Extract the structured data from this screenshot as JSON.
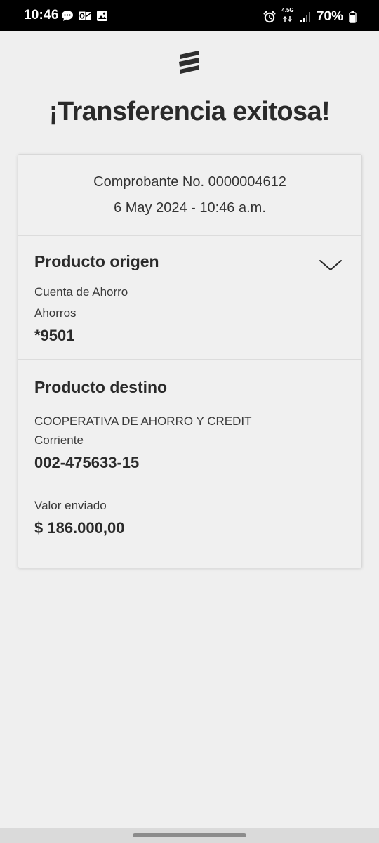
{
  "status_bar": {
    "time": "10:46",
    "network": "4.5G",
    "battery": "70%"
  },
  "page": {
    "title": "¡Transferencia exitosa!"
  },
  "receipt": {
    "number_line": "Comprobante No. 0000004612",
    "datetime": "6 May 2024 - 10:46 a.m."
  },
  "origin": {
    "title": "Producto origen",
    "account_type": "Cuenta de Ahorro",
    "sub_type": "Ahorros",
    "account_number": "*9501"
  },
  "destination": {
    "title": "Producto destino",
    "entity": "COOPERATIVA DE AHORRO Y CREDIT",
    "account_type": "Corriente",
    "account_number": "002-475633-15",
    "amount_label": "Valor enviado",
    "amount": "$ 186.000,00"
  },
  "icons": {
    "chat": "message-bubble-icon",
    "outlook": "mail-app-icon",
    "gallery": "image-icon",
    "alarm": "alarm-icon",
    "signal": "signal-icon",
    "battery": "battery-icon",
    "logo": "bank-logo-icon",
    "expand": "chevron-down-icon"
  }
}
